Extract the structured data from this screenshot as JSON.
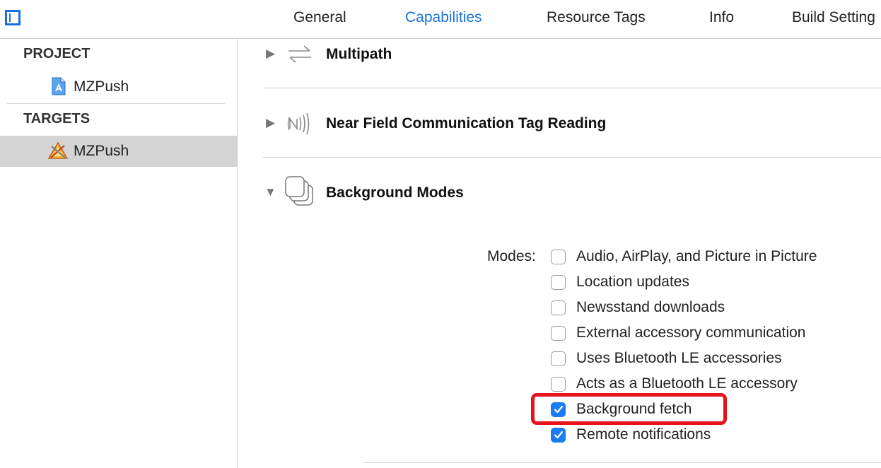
{
  "tabs": {
    "general": "General",
    "capabilities": "Capabilities",
    "resource_tags": "Resource Tags",
    "info": "Info",
    "build_settings": "Build Setting"
  },
  "active_tab": "Capabilities",
  "accent_color": "#1a73d9",
  "sidebar": {
    "project_heading": "PROJECT",
    "project_item": "MZPush",
    "targets_heading": "TARGETS",
    "target_item": "MZPush"
  },
  "sections": {
    "multipath": {
      "title": "Multipath",
      "icon": "multipath-icon",
      "expanded": false
    },
    "nfc": {
      "title": "Near Field Communication Tag Reading",
      "icon": "nfc-icon",
      "expanded": false
    },
    "background_modes": {
      "title": "Background Modes",
      "icon": "background-modes-icon",
      "expanded": true
    }
  },
  "modes": {
    "label": "Modes:",
    "items": [
      {
        "label": "Audio, AirPlay, and Picture in Picture",
        "checked": false
      },
      {
        "label": "Location updates",
        "checked": false
      },
      {
        "label": "Newsstand downloads",
        "checked": false
      },
      {
        "label": "External accessory communication",
        "checked": false
      },
      {
        "label": "Uses Bluetooth LE accessories",
        "checked": false
      },
      {
        "label": "Acts as a Bluetooth LE accessory",
        "checked": false
      },
      {
        "label": "Background fetch",
        "checked": true
      },
      {
        "label": "Remote notifications",
        "checked": true
      }
    ]
  },
  "highlight_color": "#e8141c"
}
